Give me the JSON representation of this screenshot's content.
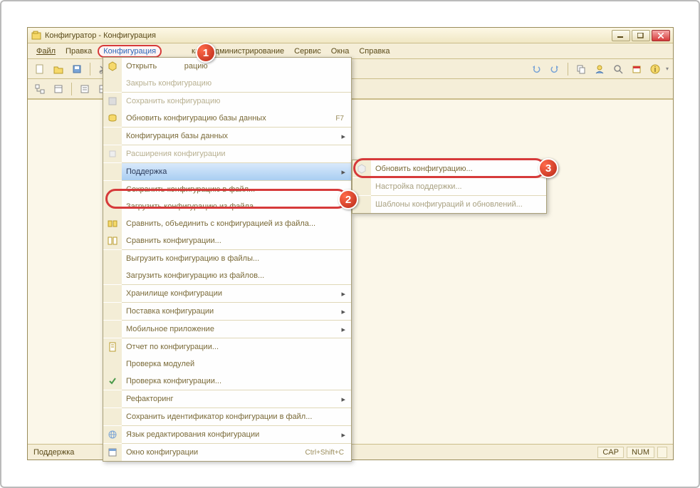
{
  "window": {
    "title": "Конфигуратор - Конфигурация"
  },
  "menubar": {
    "file": "Файл",
    "edit": "Правка",
    "config": "Конфигурация",
    "debug": "ка",
    "admin": "Администрирование",
    "service": "Сервис",
    "windows": "Окна",
    "help": "Справка"
  },
  "dropdown": {
    "open": "Открыть",
    "open_suffix": "рацию",
    "close": "Закрыть конфигурацию",
    "save": "Сохранить конфигурацию",
    "update_db": "Обновить конфигурацию базы данных",
    "update_db_shortcut": "F7",
    "db_config": "Конфигурация базы данных",
    "extensions": "Расширения конфигурации",
    "support": "Поддержка",
    "save_to_file": "Сохранить конфигурацию в файл...",
    "load_from_file": "Загрузить конфигурацию из файла...",
    "compare_merge": "Сравнить, объединить с конфигурацией из файла...",
    "compare": "Сравнить конфигурации...",
    "export_files": "Выгрузить конфигурацию в файлы...",
    "import_files": "Загрузить конфигурацию из файлов...",
    "repository": "Хранилище конфигурации",
    "delivery": "Поставка конфигурации",
    "mobile": "Мобильное приложение",
    "report": "Отчет по конфигурации...",
    "check_modules": "Проверка модулей",
    "check_config": "Проверка конфигурации...",
    "refactoring": "Рефакторинг",
    "save_id": "Сохранить идентификатор конфигурации в файл...",
    "edit_lang": "Язык редактирования конфигурации",
    "config_window": "Окно конфигурации",
    "config_window_shortcut": "Ctrl+Shift+C"
  },
  "submenu": {
    "update_config": "Обновить конфигурацию...",
    "support_settings": "Настройка поддержки...",
    "templates": "Шаблоны конфигураций и обновлений..."
  },
  "statusbar": {
    "hint": "Поддержка",
    "cap": "CAP",
    "num": "NUM"
  },
  "badges": {
    "b1": "1",
    "b2": "2",
    "b3": "3"
  }
}
